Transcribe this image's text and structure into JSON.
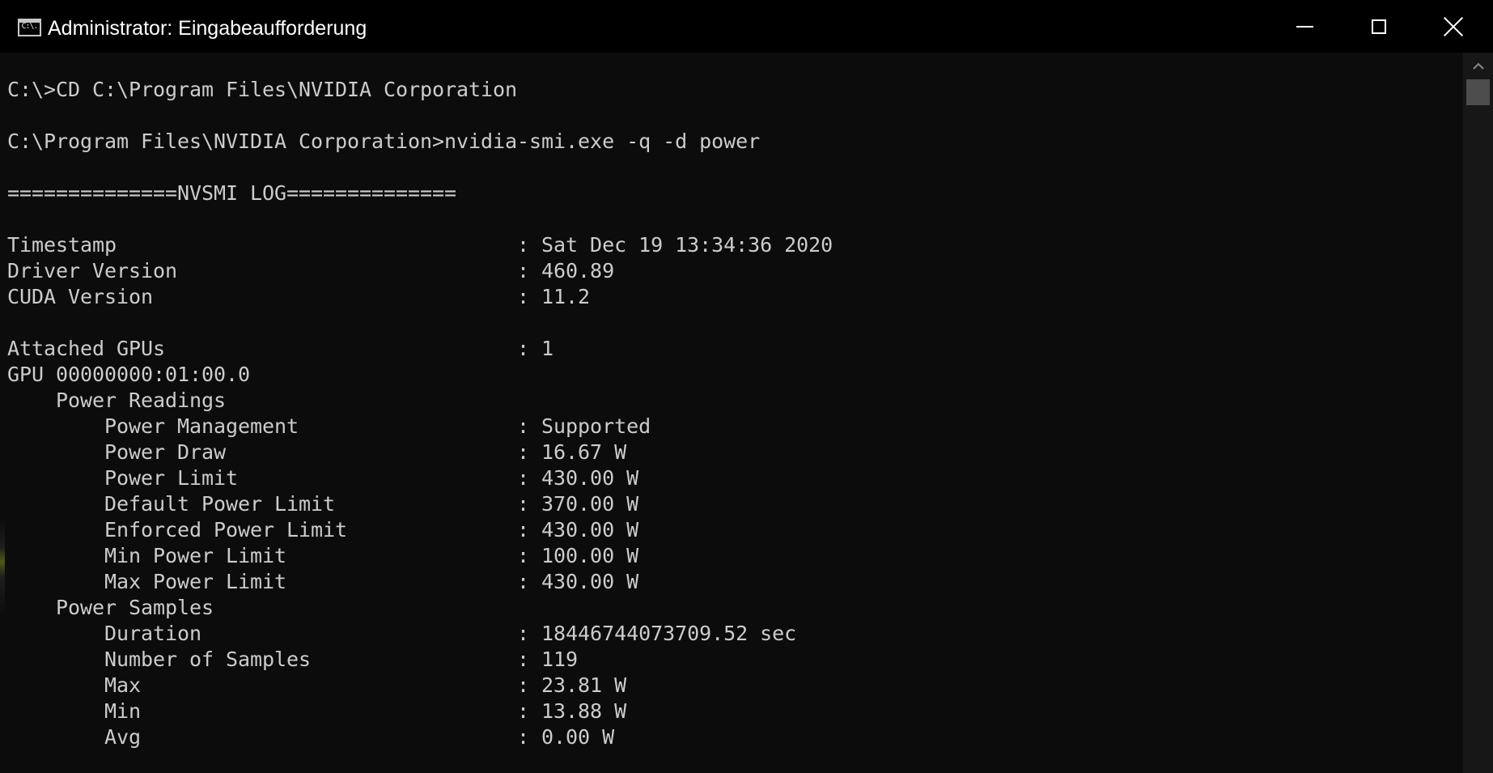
{
  "window": {
    "title": "Administrator: Eingabeaufforderung",
    "icon_label": "C:\\.",
    "icon": "cmd-icon",
    "controls": {
      "minimize_icon": "minimize-icon",
      "maximize_icon": "maximize-icon",
      "close_icon": "close-icon"
    }
  },
  "console": {
    "lines": [
      "C:\\>CD C:\\Program Files\\NVIDIA Corporation",
      "",
      "C:\\Program Files\\NVIDIA Corporation>nvidia-smi.exe -q -d power",
      "",
      "==============NVSMI LOG==============",
      "",
      "Timestamp                                 : Sat Dec 19 13:34:36 2020",
      "Driver Version                            : 460.89",
      "CUDA Version                              : 11.2",
      "",
      "Attached GPUs                             : 1",
      "GPU 00000000:01:00.0",
      "    Power Readings",
      "        Power Management                  : Supported",
      "        Power Draw                        : 16.67 W",
      "        Power Limit                       : 430.00 W",
      "        Default Power Limit               : 370.00 W",
      "        Enforced Power Limit              : 430.00 W",
      "        Min Power Limit                   : 100.00 W",
      "        Max Power Limit                   : 430.00 W",
      "    Power Samples",
      "        Duration                          : 18446744073709.52 sec",
      "        Number of Samples                 : 119",
      "        Max                               : 23.81 W",
      "        Min                               : 13.88 W",
      "        Avg                               : 0.00 W"
    ]
  },
  "colors": {
    "background": "#0c0c0c",
    "text": "#cccccc",
    "titlebar": "#000000",
    "scrollbar_track": "#171717",
    "scrollbar_thumb": "#4d4d4d"
  }
}
